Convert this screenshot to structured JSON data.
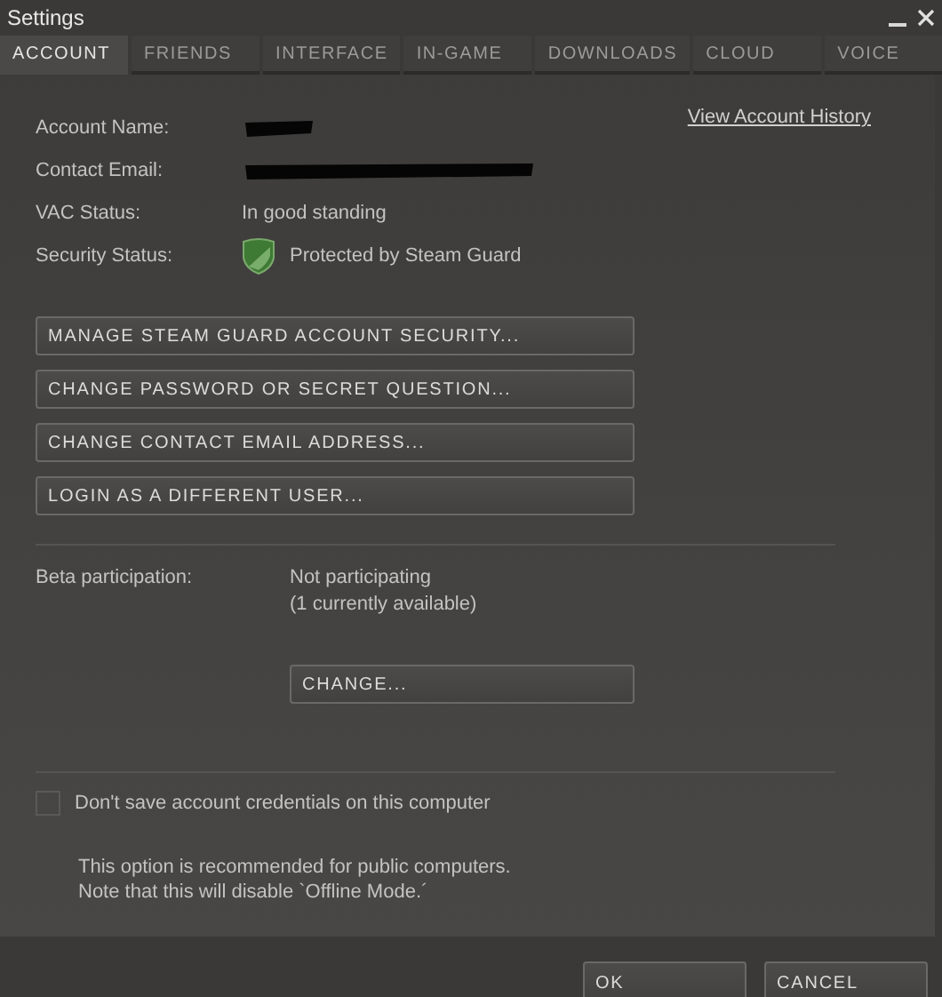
{
  "window": {
    "title": "Settings"
  },
  "tabs": [
    {
      "label": "ACCOUNT",
      "selected": true
    },
    {
      "label": "FRIENDS",
      "selected": false
    },
    {
      "label": "INTERFACE",
      "selected": false
    },
    {
      "label": "IN-GAME",
      "selected": false
    },
    {
      "label": "DOWNLOADS",
      "selected": false
    },
    {
      "label": "CLOUD",
      "selected": false
    },
    {
      "label": "VOICE",
      "selected": false
    }
  ],
  "account": {
    "link": "View Account History",
    "fields": [
      {
        "label": "Account Name:",
        "kind": "redacted"
      },
      {
        "label": "Contact Email:",
        "kind": "redacted"
      },
      {
        "label": "VAC Status:",
        "kind": "text",
        "value": "In good standing"
      },
      {
        "label": "Security Status:",
        "kind": "shield",
        "value": "Protected by Steam Guard"
      }
    ],
    "actions": [
      "MANAGE STEAM GUARD ACCOUNT SECURITY...",
      "CHANGE PASSWORD OR SECRET QUESTION...",
      "CHANGE CONTACT EMAIL ADDRESS...",
      "LOGIN AS A DIFFERENT USER..."
    ]
  },
  "beta": {
    "label": "Beta participation:",
    "status": "Not participating",
    "available": "(1 currently available)",
    "button": "CHANGE..."
  },
  "credentials": {
    "label": "Don't save account credentials on this computer",
    "checked": false,
    "note": [
      "This option is recommended for public computers.",
      "Note that this will disable `Offline Mode.´"
    ]
  },
  "buttons": [
    "OK",
    "CANCEL"
  ]
}
